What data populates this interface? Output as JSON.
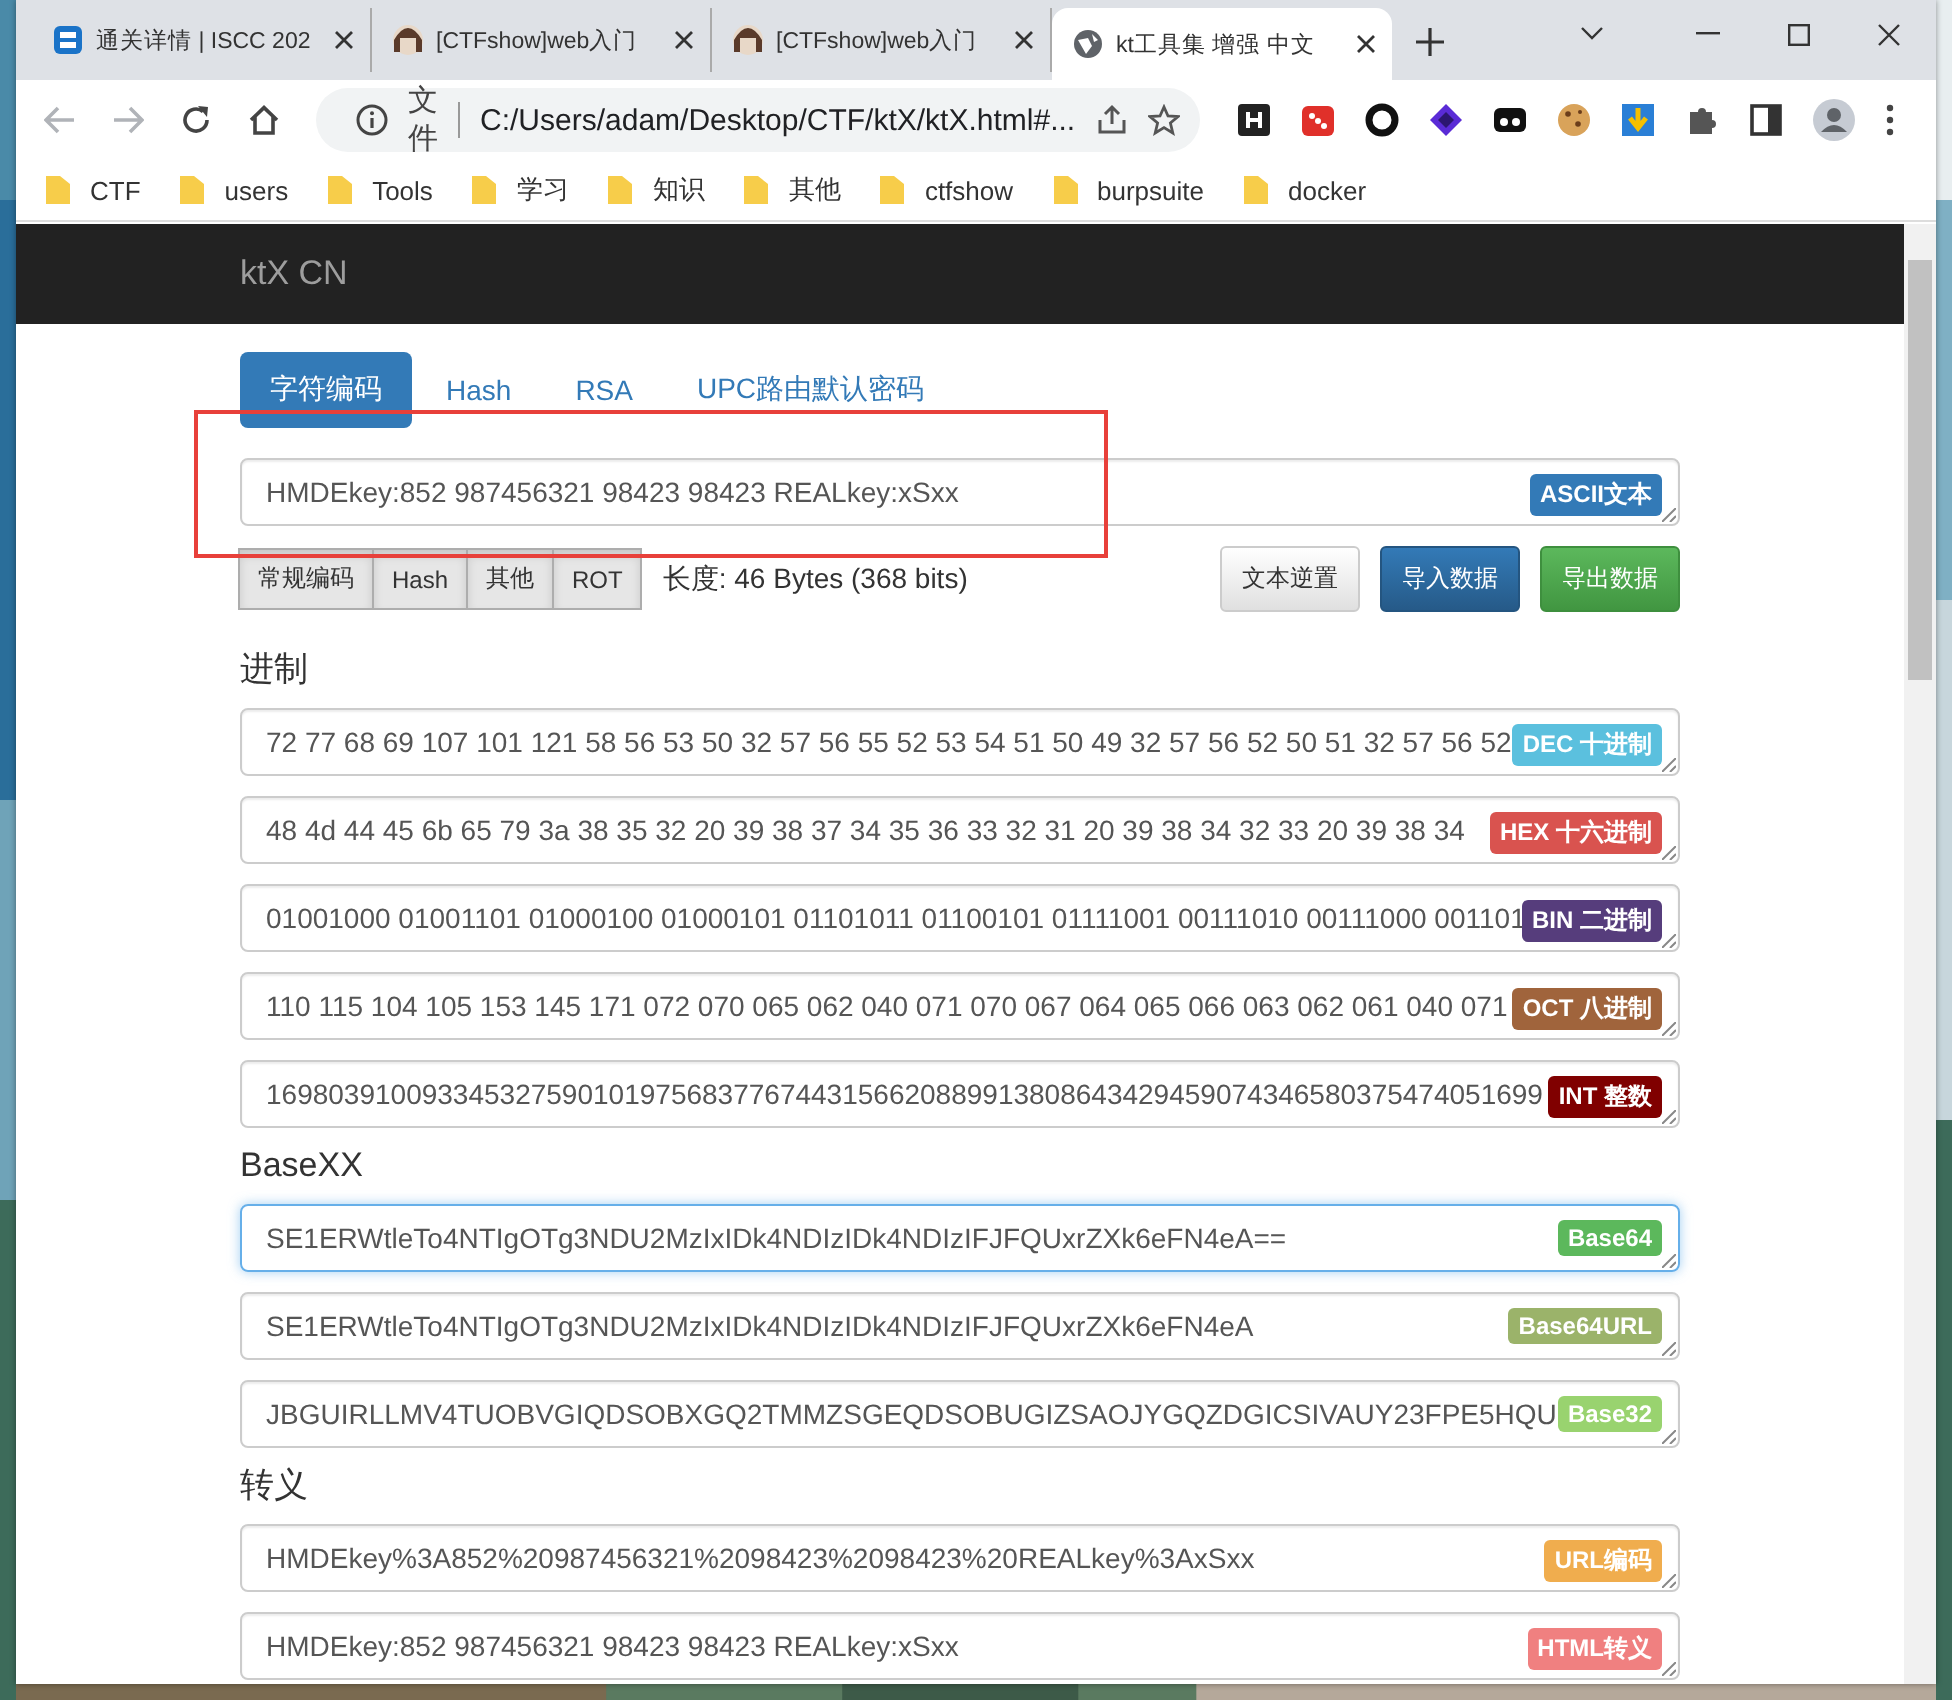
{
  "browser": {
    "tabs": [
      {
        "title": "通关详情 | ISCC 202",
        "kind": "logo",
        "selected": false
      },
      {
        "title": "[CTFshow]web入门",
        "kind": "avatar",
        "selected": false
      },
      {
        "title": "[CTFshow]web入门",
        "kind": "avatar",
        "selected": false
      },
      {
        "title": "kt工具集 增强 中文",
        "kind": "globe",
        "selected": true
      }
    ],
    "address": {
      "scheme_label": "文件",
      "url": "C:/Users/adam/Desktop/CTF/ktX/ktX.html#..."
    },
    "bookmarks": [
      "CTF",
      "users",
      "Tools",
      "学习",
      "知识",
      "其他",
      "ctfshow",
      "burpsuite",
      "docker"
    ]
  },
  "page": {
    "brand": "ktX CN",
    "nav_tabs": [
      {
        "label": "字符编码",
        "selected": true
      },
      {
        "label": "Hash",
        "selected": false
      },
      {
        "label": "RSA",
        "selected": false
      },
      {
        "label": "UPC路由默认密码",
        "selected": false
      }
    ],
    "input": {
      "value": "HMDEkey:852 987456321 98423 98423 REALkey:xSxx",
      "badge": "ASCII文本",
      "color": "#337ab7"
    },
    "encode_buttons": [
      "常规编码",
      "Hash",
      "其他",
      "ROT"
    ],
    "length": "长度: 46 Bytes (368 bits)",
    "actions": [
      {
        "label": "文本逆置",
        "kind": "default"
      },
      {
        "label": "导入数据",
        "kind": "primary"
      },
      {
        "label": "导出数据",
        "kind": "success"
      }
    ],
    "sections": [
      {
        "heading": "进制",
        "fields": [
          {
            "value": "72 77 68 69 107 101 121 58 56 53 50 32 57 56 55 52 53 54 51 50 49 32 57 56 52 50 51 32 57 56 52",
            "badge": "DEC 十进制",
            "color": "#5bc0de",
            "focused": false
          },
          {
            "value": "48 4d 44 45 6b 65 79 3a 38 35 32 20 39 38 37 34 35 36 33 32 31 20 39 38 34 32 33 20 39 38 34",
            "badge": "HEX 十六进制",
            "color": "#d9534f",
            "focused": false
          },
          {
            "value": "01001000 01001101 01000100 01000101 01101011 01100101 01111001 00111010 00111000 001101",
            "badge": "BIN 二进制",
            "color": "#563d7c",
            "focused": false
          },
          {
            "value": "110 115 104 105 153 145 171 072 070 065 062 040 071 070 067 064 065 066 063 062 061 040 071",
            "badge": "OCT 八进制",
            "color": "#a0643c",
            "focused": false
          },
          {
            "value": "1698039100933453275901019756837767443156620889913808643429459074346580375474051699",
            "badge": "INT 整数",
            "color": "#800000",
            "focused": false
          }
        ]
      },
      {
        "heading": "BaseXX",
        "fields": [
          {
            "value": "SE1ERWtleTo4NTIgOTg3NDU2MzIxIDk4NDIzIDk4NDIzIFJFQUxrZXk6eFN4eA==",
            "badge": "Base64",
            "color": "#5cb85c",
            "focused": true
          },
          {
            "value": "SE1ERWtleTo4NTIgOTg3NDU2MzIxIDk4NDIzIDk4NDIzIFJFQUxrZXk6eFN4eA",
            "badge": "Base64URL",
            "color": "#9bb36a",
            "focused": false
          },
          {
            "value": "JBGUIRLLMV4TUOBVGIQDSOBXGQ2TMMZSGEQDSOBUGIZSAOJYGQZDGICSIVAUY23FPE5HQU",
            "badge": "Base32",
            "color": "#99d36f",
            "focused": false
          }
        ]
      },
      {
        "heading": "转义",
        "fields": [
          {
            "value": "HMDEkey%3A852%20987456321%2098423%2098423%20REALkey%3AxSxx",
            "badge": "URL编码",
            "color": "#f0ad4e",
            "focused": false
          },
          {
            "value": "HMDEkey:852 987456321 98423 98423 REALkey:xSxx",
            "badge": "HTML转义",
            "color": "#f08080",
            "focused": false
          }
        ]
      }
    ]
  }
}
